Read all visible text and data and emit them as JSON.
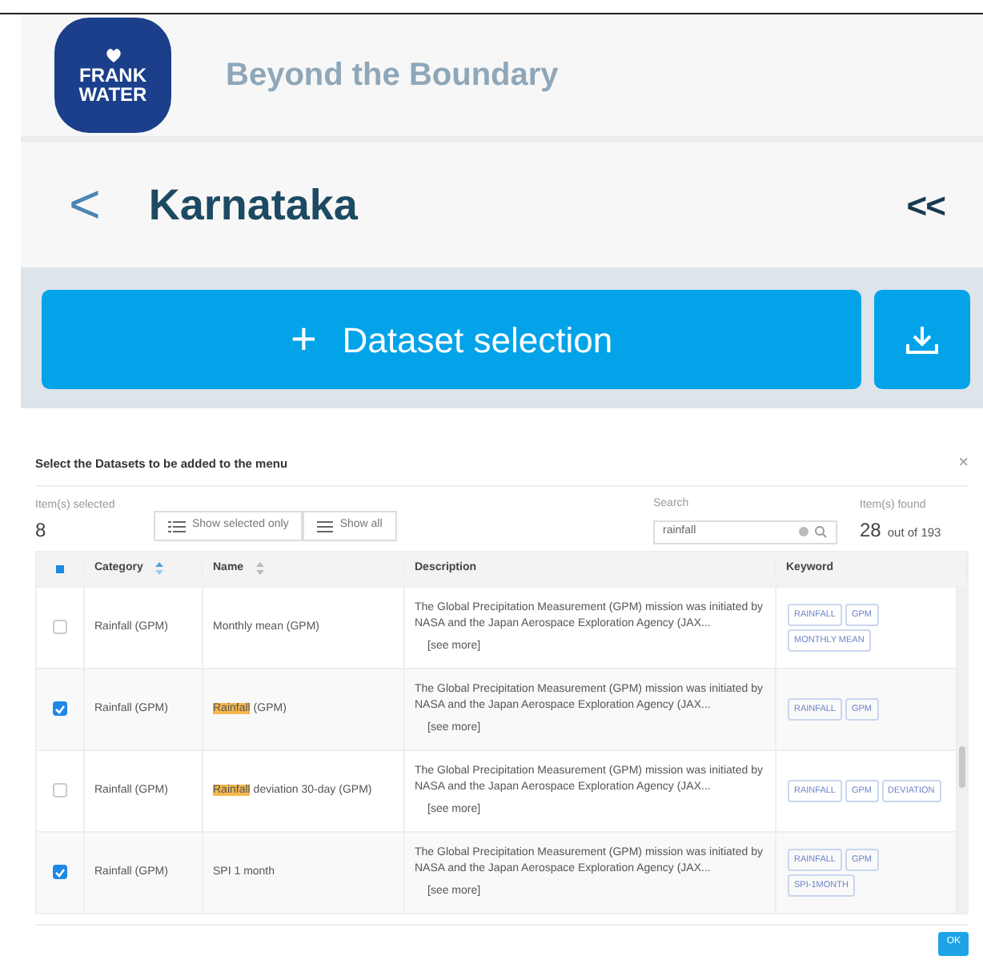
{
  "brand": {
    "logo_lines": [
      "FRANK",
      "WATER"
    ],
    "title": "Beyond the Boundary"
  },
  "region": {
    "back": "<",
    "name": "Karnataka",
    "collapse": "<<"
  },
  "actions": {
    "add_label": "Dataset selection",
    "add_symbol": "+"
  },
  "modal": {
    "title": "Select the Datasets to be added to the menu",
    "close": "×",
    "selected_label": "Item(s) selected",
    "selected_count": "8",
    "filters": [
      {
        "label": "Show selected only",
        "kind": "selected"
      },
      {
        "label": "Show all",
        "kind": "all"
      }
    ],
    "search_label": "Search",
    "search_value": "rainfall",
    "found_label": "Item(s) found",
    "found_count": "28",
    "found_total": "out of 193",
    "select_all": {
      "checked": false,
      "partial": true
    },
    "columns": [
      {
        "label": "Category",
        "sortable": true,
        "sorted": true
      },
      {
        "label": "Name",
        "sortable": true,
        "sorted": false
      },
      {
        "label": "Description"
      },
      {
        "label": "Keyword"
      }
    ],
    "rows": [
      {
        "checked": false,
        "category": "Rainfall (GPM)",
        "name": [
          {
            "text": "Monthly mean (GPM)",
            "highlighted": false
          }
        ],
        "description": "The Global Precipitation Measurement (GPM) mission was initiated by NASA and the Japan Aerospace Exploration Agency (JAX...",
        "more": "[see more]",
        "keywords": [
          "RAINFALL",
          "GPM",
          "MONTHLY MEAN"
        ]
      },
      {
        "checked": true,
        "category": "Rainfall (GPM)",
        "name": [
          {
            "text": "Rainfall",
            "highlighted": true
          },
          {
            "text": " (GPM)",
            "highlighted": false
          }
        ],
        "description": "The Global Precipitation Measurement (GPM) mission was initiated by NASA and the Japan Aerospace Exploration Agency (JAX...",
        "more": "[see more]",
        "keywords": [
          "RAINFALL",
          "GPM"
        ]
      },
      {
        "checked": false,
        "category": "Rainfall (GPM)",
        "name": [
          {
            "text": "Rainfall",
            "highlighted": true
          },
          {
            "text": " deviation 30-day (GPM)",
            "highlighted": false
          }
        ],
        "description": "The Global Precipitation Measurement (GPM) mission was initiated by NASA and the Japan Aerospace Exploration Agency (JAX...",
        "more": "[see more]",
        "keywords": [
          "RAINFALL",
          "GPM",
          "DEVIATION"
        ]
      },
      {
        "checked": true,
        "category": "Rainfall (GPM)",
        "name": [
          {
            "text": "SPI 1 month",
            "highlighted": false
          }
        ],
        "description": "The Global Precipitation Measurement (GPM) mission was initiated by NASA and the Japan Aerospace Exploration Agency (JAX...",
        "more": "[see more]",
        "keywords": [
          "RAINFALL",
          "GPM",
          "SPI-1MONTH"
        ]
      }
    ],
    "ok": "OK"
  }
}
